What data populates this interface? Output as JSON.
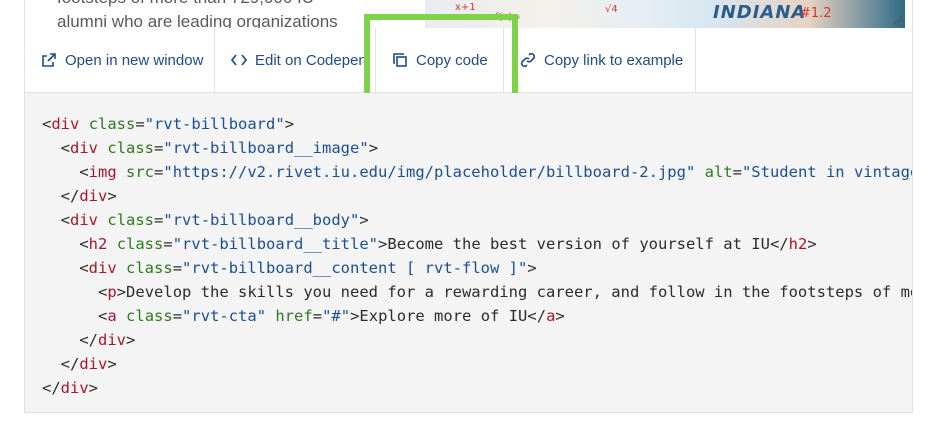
{
  "preview": {
    "text_lines": [
      "footsteps of more than 729,000 IU",
      "alumni who are leading organizations"
    ],
    "banner_word": "INDIANA",
    "scribbles": [
      "x+1",
      "f(x)=",
      "#1.2",
      "√4"
    ]
  },
  "toolbar": {
    "open_new_window": "Open in new window",
    "edit_codepen": "Edit on Codepen",
    "copy_code": "Copy code",
    "copy_link": "Copy link to example"
  },
  "code_lines": [
    {
      "indent": "",
      "open": "div",
      "attrs": [
        {
          "name": "class",
          "value": "rvt-billboard"
        }
      ],
      "close": ""
    },
    {
      "indent": "  ",
      "open": "div",
      "attrs": [
        {
          "name": "class",
          "value": "rvt-billboard__image"
        }
      ],
      "close": ""
    },
    {
      "indent": "    ",
      "open": "img",
      "attrs": [
        {
          "name": "src",
          "value": "https://v2.rivet.iu.edu/img/placeholder/billboard-2.jpg"
        },
        {
          "name": "alt",
          "value": "Student in vintage"
        }
      ],
      "close": ""
    },
    {
      "indent": "  ",
      "end": "div"
    },
    {
      "indent": "  ",
      "open": "div",
      "attrs": [
        {
          "name": "class",
          "value": "rvt-billboard__body"
        }
      ],
      "close": ""
    },
    {
      "indent": "    ",
      "open": "h2",
      "attrs": [
        {
          "name": "class",
          "value": "rvt-billboard__title"
        }
      ],
      "text": "Become the best version of yourself at IU",
      "close": "h2"
    },
    {
      "indent": "    ",
      "open": "div",
      "attrs": [
        {
          "name": "class",
          "value": "rvt-billboard__content [ rvt-flow ]"
        }
      ],
      "close": ""
    },
    {
      "indent": "      ",
      "open": "p",
      "attrs": [],
      "text": "Develop the skills you need for a rewarding career, and follow in the footsteps of more",
      "close": ""
    },
    {
      "indent": "      ",
      "open": "a",
      "attrs": [
        {
          "name": "class",
          "value": "rvt-cta"
        },
        {
          "name": "href",
          "value": "#"
        }
      ],
      "text": "Explore more of IU",
      "close": "a"
    },
    {
      "indent": "    ",
      "end": "div"
    },
    {
      "indent": "  ",
      "end": "div"
    },
    {
      "indent": "",
      "end": "div"
    }
  ],
  "colors": {
    "link": "#1f4b86",
    "highlight": "#7ed348",
    "tag": "#a8162b",
    "attr": "#2f7a20",
    "value": "#1b4f92",
    "code_bg": "#f4f4f4"
  }
}
